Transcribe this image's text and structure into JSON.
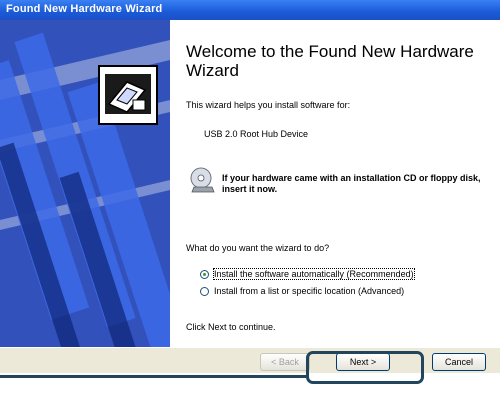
{
  "window": {
    "title": "Found New Hardware Wizard"
  },
  "content": {
    "heading": "Welcome to the Found New Hardware Wizard",
    "intro": "This wizard helps you install software for:",
    "device_name": "USB 2.0 Root Hub Device",
    "cd_note": "If your hardware came with an installation CD or floppy disk, insert it now.",
    "question": "What do you want the wizard to do?",
    "options": [
      {
        "label": "Install the software automatically (Recommended)",
        "selected": true
      },
      {
        "label": "Install from a list or specific location (Advanced)",
        "selected": false
      }
    ],
    "continue_text": "Click Next to continue."
  },
  "buttons": {
    "back": "< Back",
    "next": "Next >",
    "cancel": "Cancel"
  },
  "colors": {
    "titlebar": "#1a5ad8",
    "side_panel_dark": "#1f3fb0",
    "annotation": "#22455e"
  },
  "icons": {
    "wizard": "hardware-box-icon",
    "cd": "cd-disc-icon"
  }
}
